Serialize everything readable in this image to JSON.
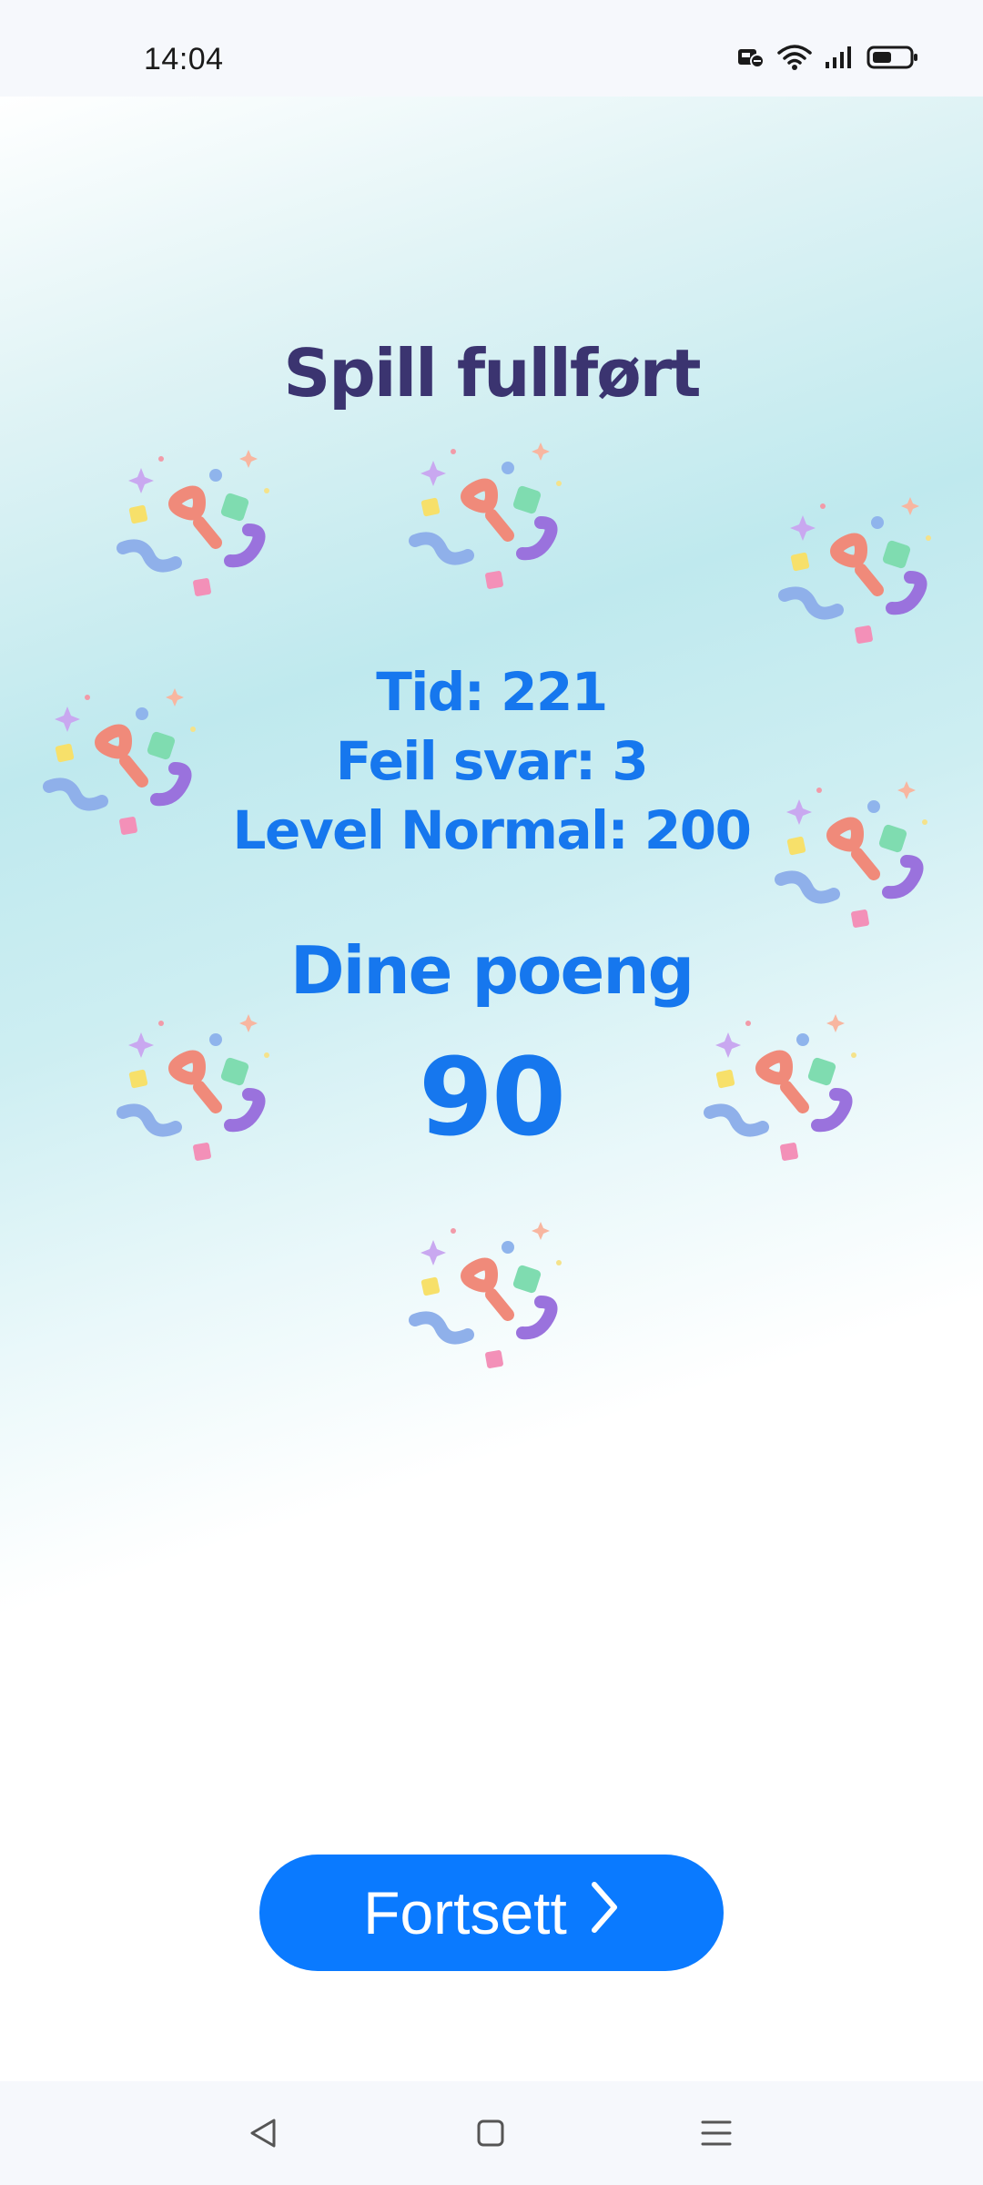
{
  "status_bar": {
    "time": "14:04",
    "icons": [
      "media-icon",
      "wifi-icon",
      "signal-icon",
      "battery-icon"
    ]
  },
  "game_over": {
    "title": "Spill fullført",
    "time_text": "Tid: 221",
    "wrong_answers_text": "Feil svar: 3",
    "level_text": "Level Normal: 200",
    "score_label": "Dine poeng",
    "score_value": "90"
  },
  "continue_button": {
    "label": "Fortsett",
    "icon": "chevron-right-icon"
  },
  "nav_bar": {
    "items": [
      "back-icon",
      "home-icon",
      "menu-icon"
    ]
  },
  "colors": {
    "title": "#3b3470",
    "accent_blue": "#1677ee",
    "button_blue": "#0a7aff",
    "background_teal": "#bfe9ee"
  }
}
